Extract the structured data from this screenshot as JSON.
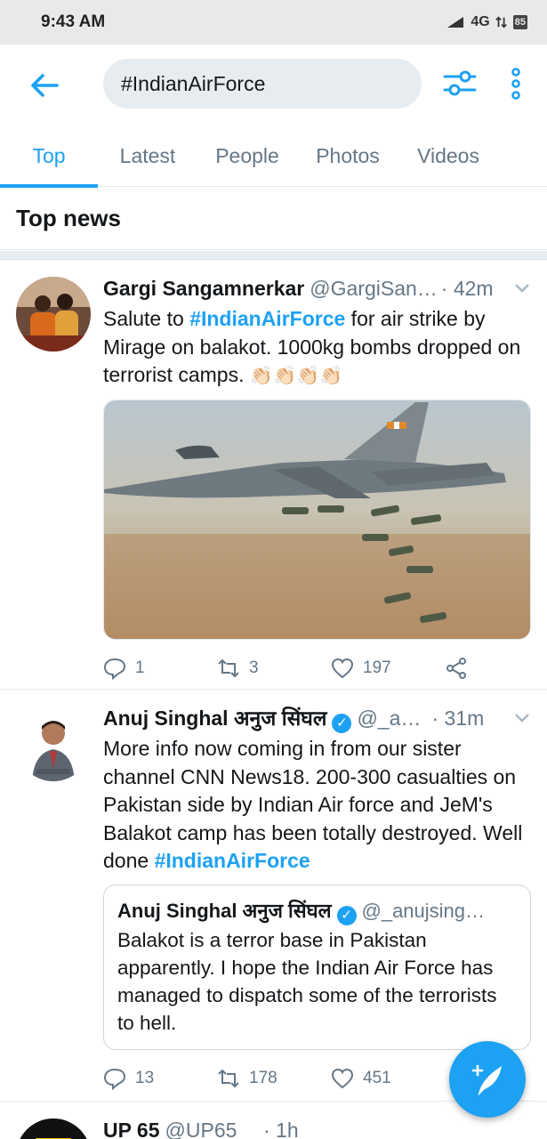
{
  "status_bar": {
    "time": "9:43 AM",
    "network": "4G",
    "battery": "85"
  },
  "search": {
    "query": "#IndianAirForce"
  },
  "tabs": [
    {
      "label": "Top",
      "active": true
    },
    {
      "label": "Latest",
      "active": false
    },
    {
      "label": "People",
      "active": false
    },
    {
      "label": "Photos",
      "active": false
    },
    {
      "label": "Videos",
      "active": false
    }
  ],
  "section": {
    "title": "Top news"
  },
  "tweets": [
    {
      "name": "Gargi Sangamnerkar",
      "handle": "@GargiSan…",
      "time": "· 42m",
      "text_before": "Salute to ",
      "hashtag": "#IndianAirForce",
      "text_after": "  for air strike by Mirage on balakot. 1000kg bombs dropped on terrorist camps. ",
      "emoji": "👏🏻👏🏻👏🏻👏🏻",
      "replies": "1",
      "retweets": "3",
      "likes": "197"
    },
    {
      "name": "Anuj Singhal अनुज सिंघल",
      "handle": "@_an…",
      "time": "· 31m",
      "verified": true,
      "text_before": "More info now coming in from our sister channel CNN News18. 200-300 casualties on Pakistan side by Indian Air force and JeM's Balakot camp has been totally destroyed. Well done ",
      "hashtag": "#IndianAirForce",
      "quote": {
        "name": "Anuj Singhal अनुज सिंघल",
        "handle": "@_anujsing…",
        "text": "Balakot is a terror base in Pakistan apparently. I hope the Indian Air Force has managed to dispatch some of the terrorists to hell."
      },
      "replies": "13",
      "retweets": "178",
      "likes": "451"
    },
    {
      "name": "UP 65",
      "handle": "@UP65__",
      "time": "· 1h"
    }
  ],
  "colors": {
    "accent": "#1da1f2",
    "secondary_text": "#657786",
    "divider": "#e1e8ed"
  }
}
